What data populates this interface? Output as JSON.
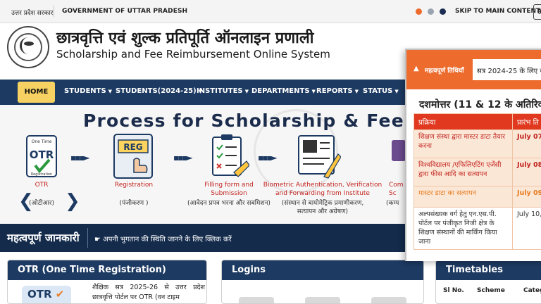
{
  "topbar": {
    "state_hi": "उत्तर प्रदेश सरकार",
    "government": "GOVERNMENT OF UTTAR PRADESH",
    "skip": "SKIP TO MAIN CONTENT",
    "lang": "अ",
    "theme_colors": [
      "#ec6b2d",
      "#9aa4b0",
      "#1b2d52"
    ]
  },
  "header": {
    "title_hi": "छात्रवृत्ति एवं शुल्क प्रतिपूर्ति ऑनलाइन प्रणाली",
    "title_en": "Scholarship and Fee Reimbursement Online System"
  },
  "nav": {
    "home": "HOME",
    "items": [
      "STUDENTS",
      "STUDENTS(2024-25)",
      "INSTITUTES",
      "DEPARTMENTS",
      "REPORTS",
      "STATUS"
    ]
  },
  "banner": {
    "heading": "Process for Scholarship & Fee R",
    "steps": [
      {
        "icon": "otr-icon",
        "label": "OTR",
        "sub": "(ओटीआर)"
      },
      {
        "icon": "registration-icon",
        "label": "Registration",
        "sub": "(पंजीकरण )"
      },
      {
        "icon": "form-icon",
        "label": "Filling form and\nSubmission",
        "sub": "(आवेदन प्रपत्र भरना और सबमिशन)"
      },
      {
        "icon": "biometric-icon",
        "label": "Biometric Authentication, Verification\nand Forwarding from Institute",
        "sub": "(संस्थान से बायोमेट्रिक प्रमाणीकरण,\nसत्यापन और अग्रेषण)"
      },
      {
        "icon": "computer-icon",
        "label": "Com\nSc",
        "sub": "(कम्प"
      }
    ],
    "otr_icon_text": "One Time",
    "otr_icon_big": "OTR",
    "otr_icon_small": "Registration",
    "reg_icon_text": "REG"
  },
  "infostrip": {
    "title": "महत्वपूर्ण जानकारी",
    "ticker": "अपनी भुगतान की स्थिति जानने के लिए क्लिक करें"
  },
  "otr_card": {
    "title": "OTR (One Time Registration)",
    "logo": "OTR",
    "desc": "शैक्षिक सत्र 2025-26 से उत्तर प्रदेश छात्रवृत्ति पोर्टल पर OTR (वन टाइम"
  },
  "logins_card": {
    "title": "Logins"
  },
  "timetables_card": {
    "title": "Timetables",
    "columns": [
      "Sl No.",
      "Scheme",
      "Categ"
    ]
  },
  "popup": {
    "label": "महत्वपूर्ण तिथियाँ",
    "marquee": "सत्र 2024-25 के लिए या",
    "title": "दशमोत्तर (11 & 12 के अतिरिक्त",
    "columns": [
      "प्रक्रिया",
      "प्रारंभ ति"
    ],
    "rows": [
      {
        "process": "शिक्षण संस्था द्वारा मास्टर डाटा तैयार करना",
        "date": "July 07"
      },
      {
        "process": "विश्वविद्यालय /एफिलिएटिंग एजेंसी द्वारा फीस आदि का सत्यापन",
        "date": "July 08"
      },
      {
        "process": "मास्टर डाटा का सत्यापन",
        "date": "July 09"
      },
      {
        "process": "अल्पसंख्यक वर्ग हेतु एन.एस.पी. पोर्टल पर पंजीकृत निजी क्षेत्र के शिक्षण संस्थानों की मार्किंग किया जाना",
        "date": "July 10,"
      }
    ]
  }
}
